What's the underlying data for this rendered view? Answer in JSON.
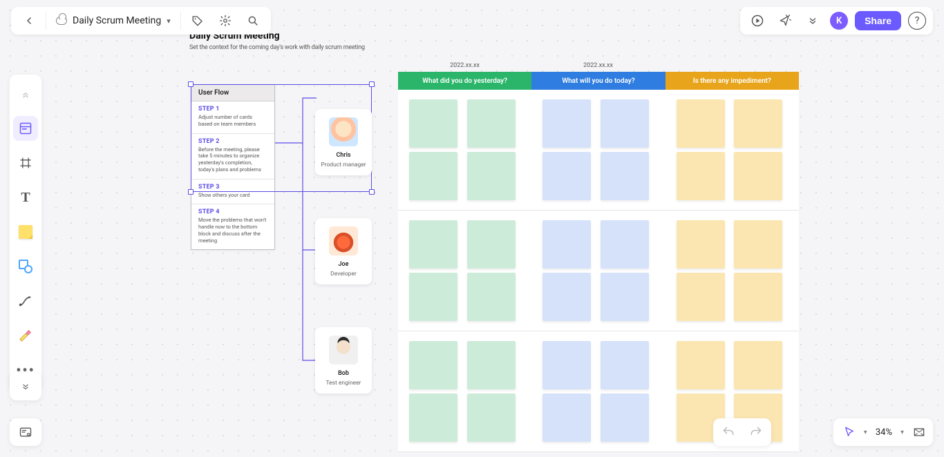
{
  "topbar": {
    "document_title": "Daily Scrum Meeting"
  },
  "topright": {
    "avatar_initial": "K",
    "share_label": "Share"
  },
  "heading": {
    "title": "Daily Scrum Meeting",
    "subtitle": "Set the context for the coming day's work with daily scrum meeting"
  },
  "userflow": {
    "title": "User Flow",
    "steps": [
      {
        "label": "STEP 1",
        "desc": "Adjust number of cards based on team members"
      },
      {
        "label": "STEP 2",
        "desc": "Before the meeting, please take 5 minutes to organize yesterday's completion, today's plans and problems"
      },
      {
        "label": "STEP 3",
        "desc": "Show others your card"
      },
      {
        "label": "STEP 4",
        "desc": "Move the problems that won't handle now to the bottom block and discuss after the meeting"
      }
    ]
  },
  "people": [
    {
      "name": "Chris",
      "role": "Product manager"
    },
    {
      "name": "Joe",
      "role": "Developer"
    },
    {
      "name": "Bob",
      "role": "Test engineer"
    }
  ],
  "table": {
    "dates": [
      "2022.xx.xx",
      "2022.xx.xx"
    ],
    "columns": [
      {
        "label": "What did you do yesterday?",
        "note_color": "#cdebd9",
        "header_color": "#2ab56a"
      },
      {
        "label": "What will you do today?",
        "note_color": "#d5e2fa",
        "header_color": "#2f7de0"
      },
      {
        "label": "Is there any impediment?",
        "note_color": "#fbe6b2",
        "header_color": "#e8a41a"
      }
    ],
    "rows": 3,
    "notes_per_cell": 4
  },
  "zoom": {
    "value": "34%"
  }
}
